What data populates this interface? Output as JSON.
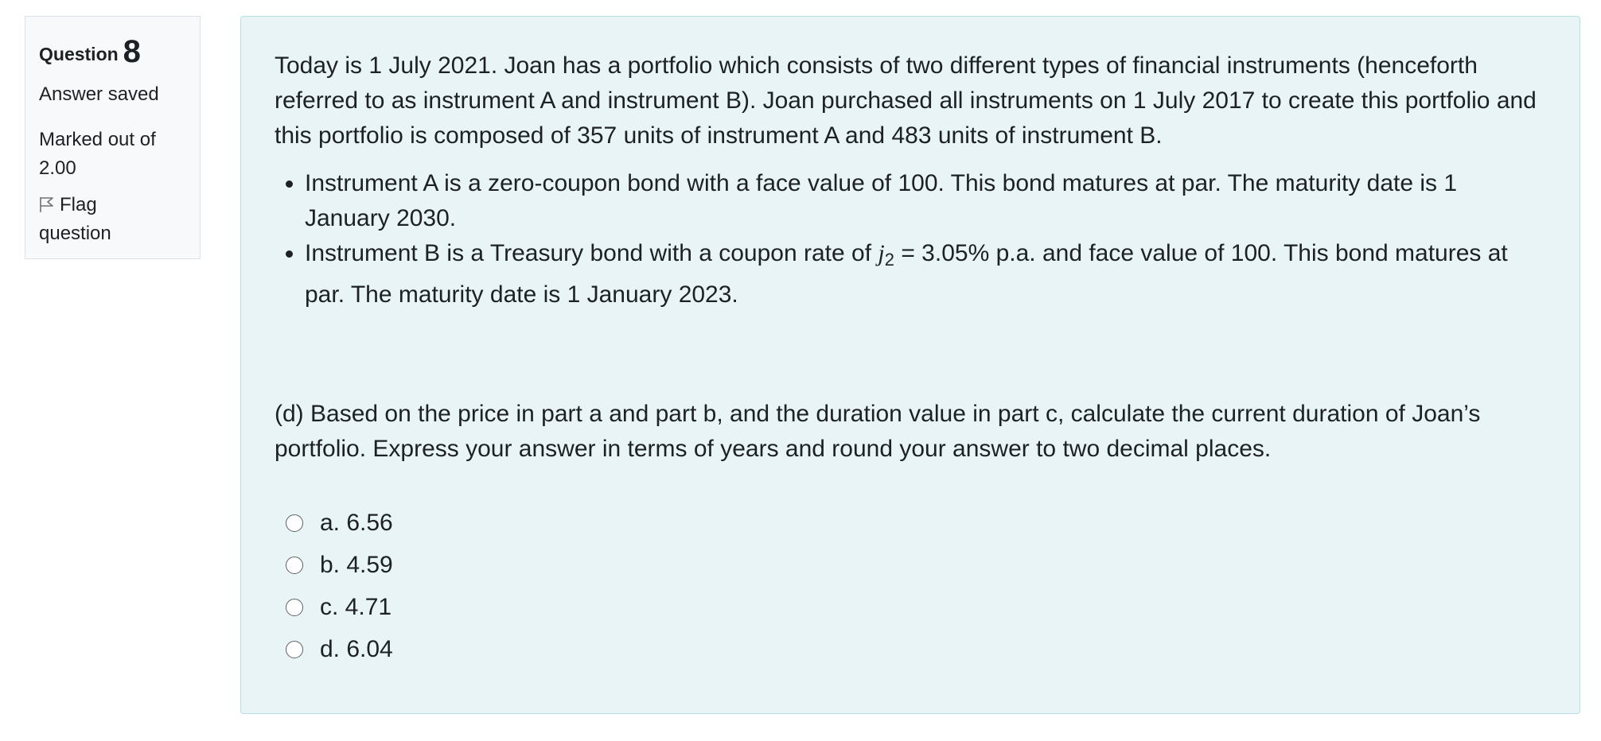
{
  "info": {
    "question_label": "Question",
    "question_number": "8",
    "state": "Answer saved",
    "grade_line1": "Marked out of",
    "grade_line2": "2.00",
    "flag_line1": "Flag",
    "flag_line2": "question",
    "flag_icon": "flag-icon"
  },
  "question": {
    "intro": "Today is 1 July 2021. Joan has a portfolio which consists of two different types of financial instruments (henceforth referred to as instrument A and instrument B). Joan purchased all instruments on 1 July 2017 to create this portfolio and this portfolio is composed of 357 units of instrument A and 483 units of instrument B.",
    "bullet_a": "Instrument A is a zero-coupon bond with a face value of 100. This bond matures at par. The maturity date is 1 January 2030.",
    "bullet_b_before": "Instrument B is a Treasury bond with a coupon rate of ",
    "bullet_b_var": "j",
    "bullet_b_sub": "2",
    "bullet_b_after": " = 3.05% p.a. and face value of 100. This bond matures at par. The maturity date is 1 January 2023.",
    "part_d": "(d) Based on the price in part a and part b, and the duration value in part c, calculate the current duration of Joan’s portfolio. Express your answer in terms of years and round your answer to two decimal places."
  },
  "options": [
    {
      "label": "a. 6.56"
    },
    {
      "label": "b. 4.59"
    },
    {
      "label": "c. 4.71"
    },
    {
      "label": "d. 6.04"
    }
  ]
}
